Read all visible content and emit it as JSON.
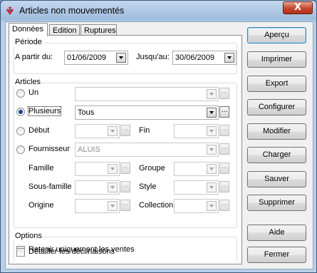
{
  "window": {
    "title": "Articles non mouvementés",
    "close_symbol": "X"
  },
  "tabs": [
    {
      "label": "Données",
      "active": true
    },
    {
      "label": "Edition",
      "active": false
    },
    {
      "label": "Ruptures",
      "active": false
    }
  ],
  "periode": {
    "group_label": "Période",
    "from_label": "A partir du:",
    "from_value": "01/06/2009",
    "to_label": "Jusqu'au:",
    "to_value": "30/06/2009"
  },
  "articles": {
    "group_label": "Articles",
    "un_label": "Un",
    "un_value": "",
    "plusieurs_label": "Plusieurs",
    "plusieurs_value": "Tous",
    "debut_label": "Début",
    "debut_value": "",
    "fin_label": "Fin",
    "fin_value": "",
    "fournisseur_label": "Fournisseur",
    "fournisseur_value": "ALUIS",
    "famille_label": "Famille",
    "groupe_label": "Groupe",
    "sous_famille_label": "Sous-famille",
    "style_label": "Style",
    "origine_label": "Origine",
    "collection_label": "Collection",
    "selected_option": "Plusieurs",
    "ellipsis": "..."
  },
  "options": {
    "group_label": "Options",
    "retenir_label": "Retenir uniquement les ventes",
    "retenir_checked": false,
    "detailler_label": "Détailler les déclinaisons",
    "detailler_checked": false
  },
  "buttons": {
    "apercu": "Aperçu",
    "imprimer": "Imprimer",
    "export": "Export",
    "configurer": "Configurer",
    "modifier": "Modifier",
    "charger": "Charger",
    "sauver": "Sauver",
    "supprimer": "Supprimer",
    "aide": "Aide",
    "fermer": "Fermer"
  },
  "colors": {
    "title_bar": "#9fbcdc",
    "close_button": "#c4462b",
    "default_button_border": "#3c7fb1"
  }
}
